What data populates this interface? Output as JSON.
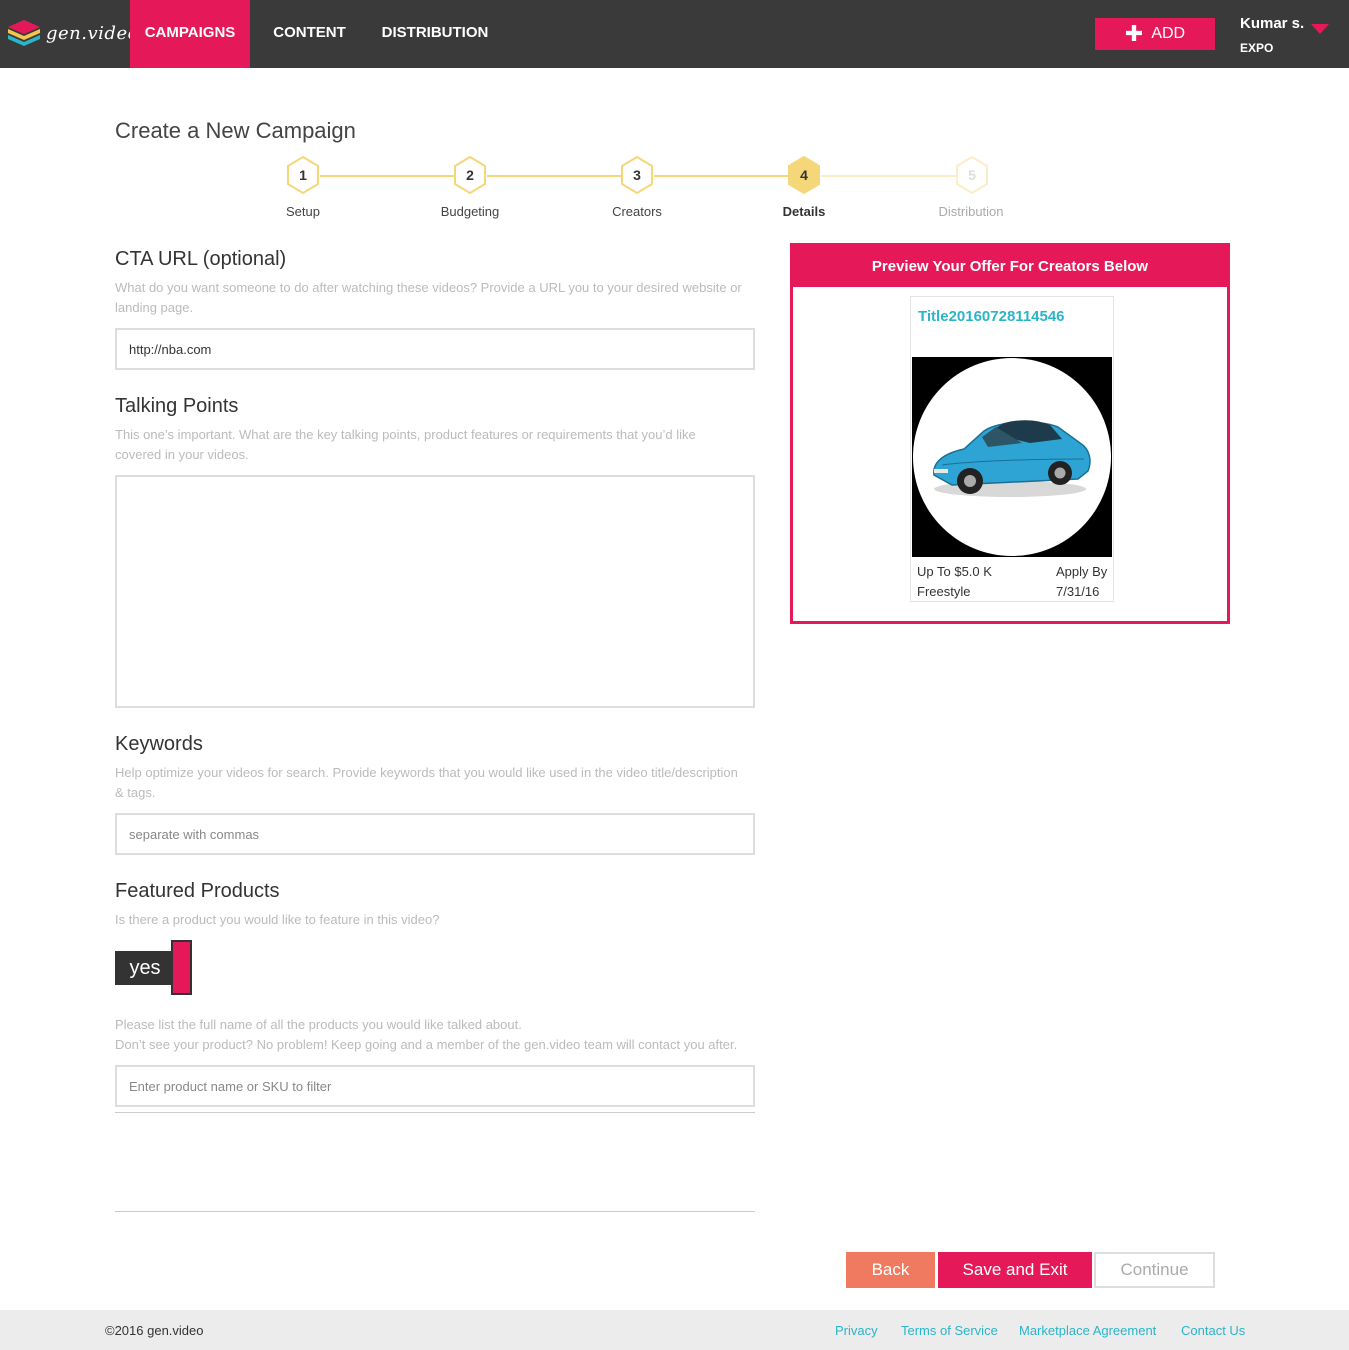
{
  "nav": {
    "logo_text": "gen.video",
    "tabs": [
      {
        "label": "CAMPAIGNS"
      },
      {
        "label": "CONTENT"
      },
      {
        "label": "DISTRIBUTION"
      }
    ],
    "add_label": "ADD",
    "user_name": "Kumar s.",
    "user_org": "EXPO"
  },
  "page_title": "Create a New Campaign",
  "steps": [
    {
      "num": "1",
      "label": "Setup"
    },
    {
      "num": "2",
      "label": "Budgeting"
    },
    {
      "num": "3",
      "label": "Creators"
    },
    {
      "num": "4",
      "label": "Details"
    },
    {
      "num": "5",
      "label": "Distribution"
    }
  ],
  "cta": {
    "title": "CTA URL (optional)",
    "help_1": "What do you want someone to do after watching these videos? Provide a URL you to your desired website or",
    "help_2": "landing page.",
    "value": "http://nba.com"
  },
  "talking_points": {
    "title": "Talking Points",
    "help_1": "This one’s important. What are the key talking points, product features or requirements that you’d like",
    "help_2": "covered in your videos.",
    "value": ""
  },
  "keywords": {
    "title": "Keywords",
    "help_1": "Help optimize your videos for search. Provide keywords that you would like used in the video title/description",
    "help_2": "& tags.",
    "placeholder": "separate with commas"
  },
  "featured": {
    "title": "Featured Products",
    "help": "Is there a product you would like to feature in this video?",
    "toggle_label": "yes",
    "list_help_1": "Please list the full name of all the products you would like talked about.",
    "list_help_2": "Don’t see your product? No problem! Keep going and a member of the gen.video team will contact you after.",
    "placeholder": "Enter product name or SKU to filter"
  },
  "preview": {
    "header": "Preview Your Offer For Creators Below",
    "card_title": "Title20160728114546",
    "budget": "Up To $5.0 K",
    "style": "Freestyle",
    "apply_label": "Apply By",
    "apply_date": "7/31/16"
  },
  "buttons": {
    "back": "Back",
    "save_exit": "Save and Exit",
    "continue": "Continue"
  },
  "footer": {
    "copyright": "©2016 gen.video",
    "links": [
      "Privacy",
      "Terms of Service",
      "Marketplace Agreement",
      "Contact Us"
    ]
  },
  "colors": {
    "brand": "#e5195a",
    "nav_bg": "#3a3a3a",
    "step_gold": "#f5d77a",
    "link": "#2ab5c8",
    "back_btn": "#f07a5f"
  },
  "icons": [
    "plus-icon",
    "caret-down-icon",
    "car-image"
  ]
}
